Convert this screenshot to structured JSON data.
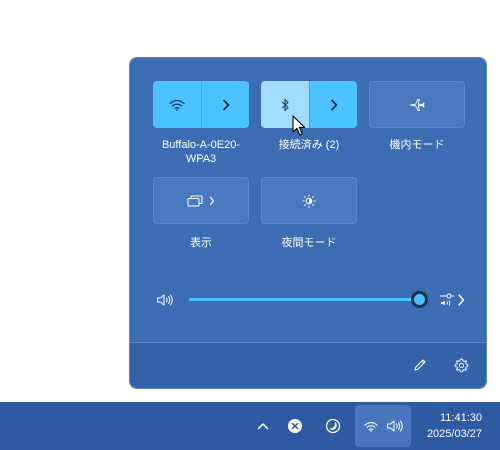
{
  "quick_settings": {
    "tiles": [
      {
        "id": "wifi",
        "label_line1": "Buffalo-A-0E20-",
        "label_line2": "WPA3",
        "state": "on"
      },
      {
        "id": "bluetooth",
        "label": "接続済み (2)",
        "state": "on"
      },
      {
        "id": "airplane",
        "label": "機内モード",
        "state": "off"
      },
      {
        "id": "display",
        "label": "表示",
        "state": "off"
      },
      {
        "id": "night_light",
        "label": "夜間モード",
        "state": "off"
      }
    ],
    "volume": {
      "level_fraction": 1.0
    }
  },
  "taskbar": {
    "clock_time": "11:41:30",
    "clock_date": "2025/03/27"
  },
  "colors": {
    "accent": "#4cc2ff",
    "flyout_bg": "#3c6cb2",
    "taskbar_bg": "#2d5aa1"
  },
  "icons": [
    "wifi-icon",
    "bluetooth-icon",
    "airplane-icon",
    "project-display-icon",
    "night-light-icon",
    "speaker-icon",
    "audio-output-icon",
    "edit-pencil-icon",
    "settings-gear-icon",
    "chevron-up-icon",
    "close-circle-icon",
    "moon-icon",
    "cursor-icon"
  ]
}
